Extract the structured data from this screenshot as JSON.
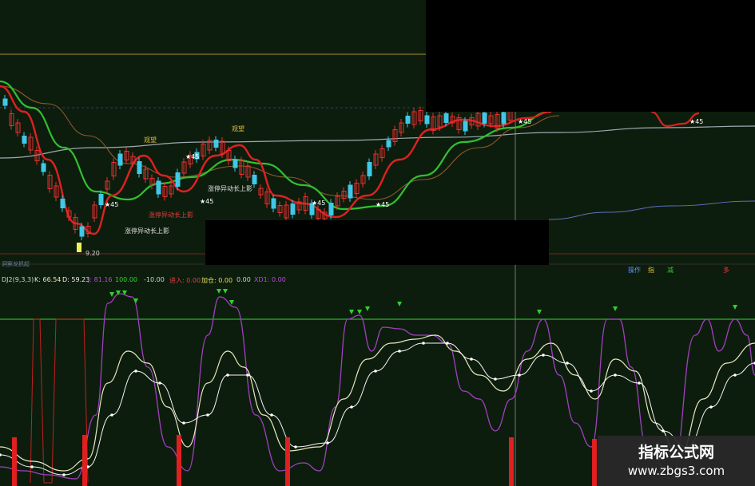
{
  "indicator_bar": {
    "name": "DJ2(9,3,3)",
    "k": "K: 66.54",
    "d": "D: 59.23",
    "j": "J: 81.16",
    "v1": "100.00",
    "v2": "-10.00",
    "entry": "进入: 0.00",
    "add": "加仓: 0.00",
    "v3": "0.00",
    "xd1": "XD1: 0.00"
  },
  "annotations": {
    "low_price": "9.20",
    "shadow_label_1": "涨停异动长上影",
    "shadow_label_2": "涨停异动长上影",
    "shadow_label_3": "涨停异动长上影",
    "watch_1": "观望",
    "watch_2": "观望",
    "star_1": "★45",
    "star_2": "★45",
    "star_3": "★45",
    "star_4": "★45",
    "star_5": "★45",
    "star_6": "★45",
    "star_7": "★45"
  },
  "top_panel_tag": "洞察龙抓起",
  "tab_buttons": [
    "操作",
    "指",
    "减",
    "多"
  ],
  "watermark": {
    "title": "指标公式网",
    "url": "www.zbgs3.com"
  },
  "colors": {
    "background": "#0d1c0d",
    "ma_red": "#e02020",
    "ma_green": "#30c030",
    "ma_brown": "#8a5a30",
    "ma_grey": "#a0a8b0",
    "k_line": "#e8e8c0",
    "d_line": "#f0f0f0",
    "j_line": "#a040c0",
    "level_line": "#30b030",
    "signal_bar": "#e02020",
    "up_arrow": "#30d030"
  },
  "chart_data": [
    {
      "type": "candlestick",
      "title": "",
      "x": [
        0,
        1,
        2,
        3,
        4,
        5,
        6,
        7,
        8,
        9,
        10,
        11,
        12,
        13,
        14,
        15,
        16,
        17,
        18,
        19,
        20,
        21,
        22,
        23,
        24,
        25,
        26,
        27,
        28,
        29,
        30,
        31,
        32,
        33,
        34,
        35,
        36,
        37,
        38,
        39,
        40,
        41,
        42,
        43,
        44,
        45,
        46,
        47,
        48,
        49,
        50,
        51,
        52,
        53,
        54,
        55,
        56,
        57,
        58,
        59,
        60,
        61,
        62,
        63,
        64,
        65,
        66,
        67,
        68,
        69,
        70,
        71,
        72,
        73,
        74,
        75,
        76,
        77,
        78,
        79,
        80,
        81,
        82,
        83,
        84,
        85
      ],
      "close_visible_min": 9.2,
      "series": [
        {
          "name": "",
          "values": []
        }
      ]
    },
    {
      "type": "line",
      "title": "DJ2(9,3,3)",
      "series": [
        {
          "name": "K",
          "last": 66.54
        },
        {
          "name": "D",
          "last": 59.23
        },
        {
          "name": "J",
          "last": 81.16
        }
      ],
      "ylim": [
        -10,
        100
      ]
    }
  ]
}
